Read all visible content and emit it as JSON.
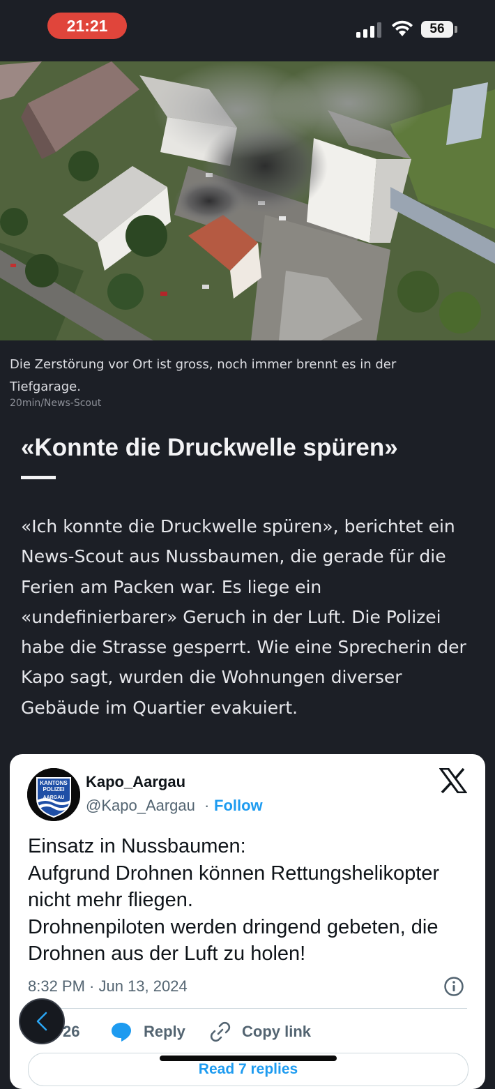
{
  "status_bar": {
    "time": "21:21",
    "battery": "56"
  },
  "article": {
    "image_caption": "Die Zerstörung vor Ort ist gross, noch immer brennt es in der Tiefgarage.",
    "image_credit": "20min/News-Scout",
    "heading": "«Konnte die Druckwelle spüren»",
    "body": "«Ich konnte die Druckwelle spüren», berichtet ein News-Scout aus Nussbaumen, die gerade für die Ferien am Packen war. Es liege ein «undefinierbarer» Geruch in der Luft. Die Polizei habe die Strasse gesperrt. Wie eine Sprecherin der Kapo sagt, wurden die Wohnungen diverser Gebäude im Quartier evakuiert."
  },
  "tweet": {
    "author_name": "Kapo_Aargau",
    "author_handle": "@Kapo_Aargau",
    "separator": "·",
    "follow_label": "Follow",
    "avatar_text": [
      "KANTONS",
      "POLIZEI",
      "AARGAU"
    ],
    "text": "Einsatz in Nussbaumen:\nAufgrund Drohnen können Rettungshelikopter nicht mehr fliegen.\nDrohnenpiloten werden dringend gebeten, die Drohnen aus der Luft zu holen!",
    "timestamp": "8:32 PM · Jun 13, 2024",
    "like_count": "26",
    "reply_label": "Reply",
    "copy_link_label": "Copy link",
    "read_replies_label": "Read 7 replies"
  },
  "icons": [
    "signal-icon",
    "wifi-icon",
    "x-logo-icon",
    "info-icon",
    "reply-icon",
    "link-icon",
    "chevron-left-icon"
  ],
  "colors": {
    "background": "#1c1f26",
    "time_pill": "#e0453b",
    "link_blue": "#1d9bf0",
    "card": "#ffffff"
  }
}
